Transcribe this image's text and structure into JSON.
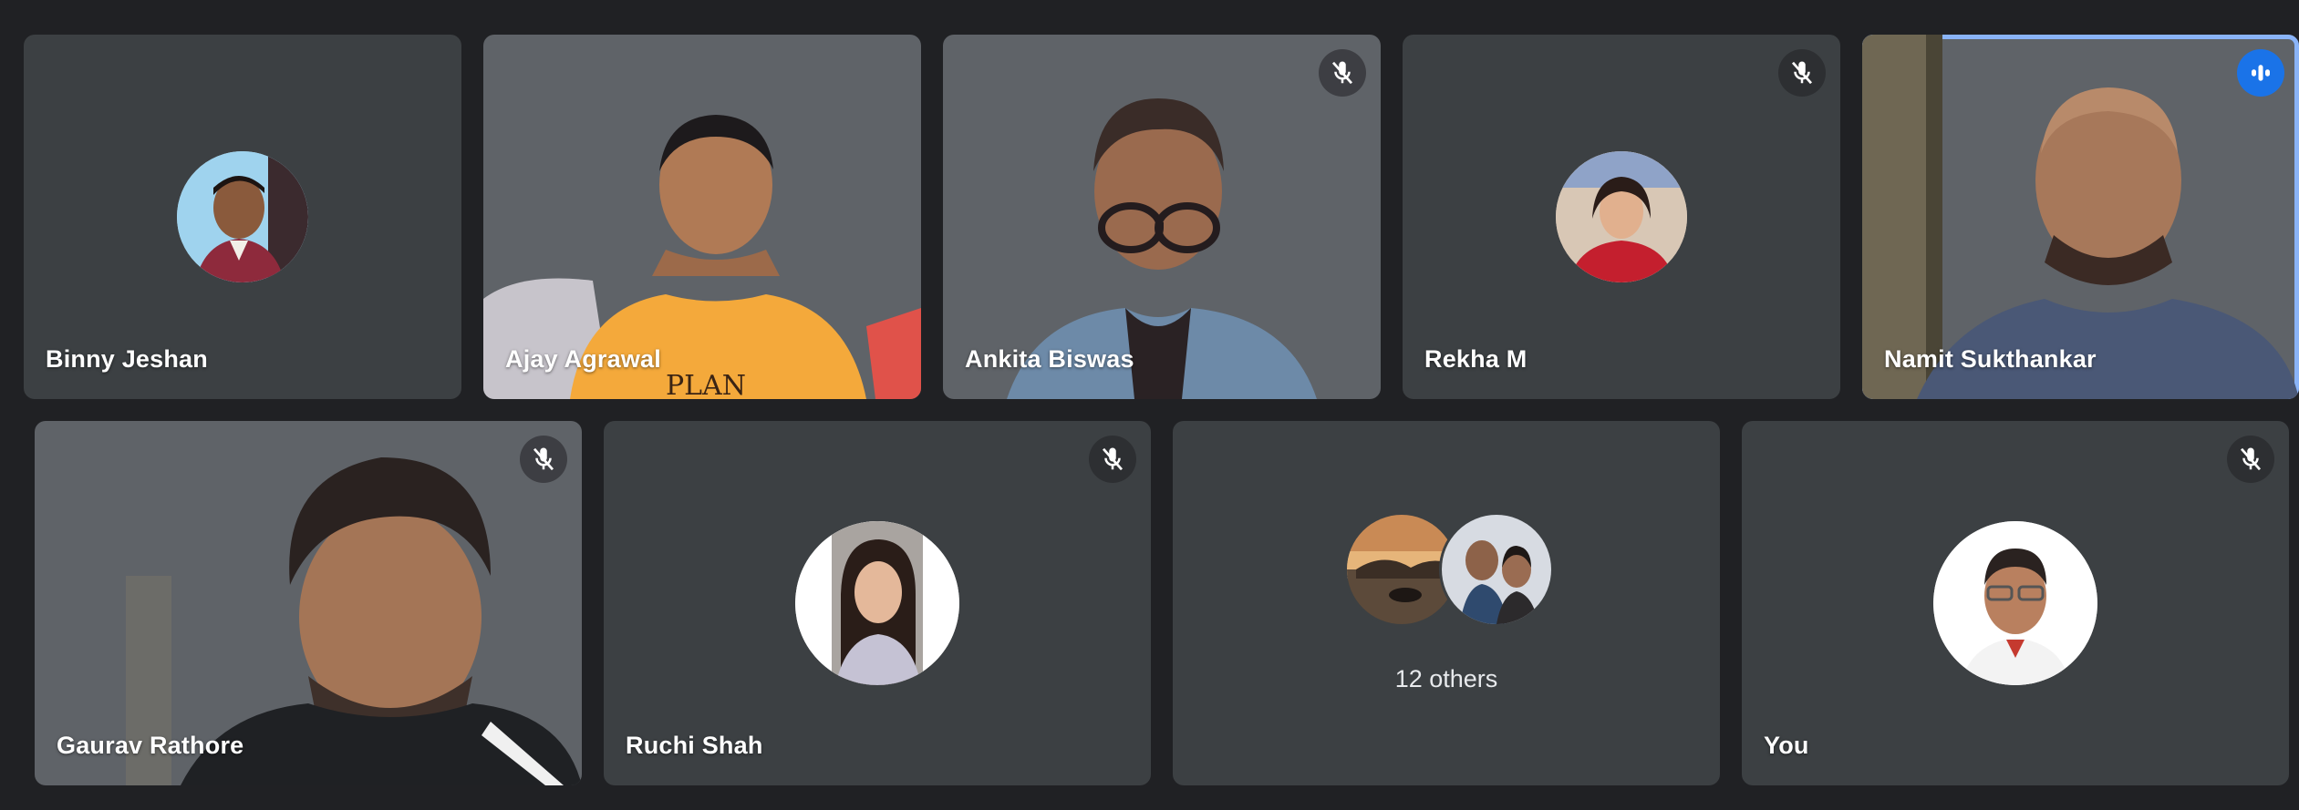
{
  "participants": [
    {
      "name": "Binny Jeshan",
      "muted": false
    },
    {
      "name": "Ajay Agrawal",
      "muted": false
    },
    {
      "name": "Ankita Biswas",
      "muted": true
    },
    {
      "name": "Rekha M",
      "muted": true
    },
    {
      "name": "Namit Sukthankar",
      "speaking": true
    },
    {
      "name": "Gaurav Rathore",
      "muted": true
    },
    {
      "name": "Ruchi Shah",
      "muted": true
    },
    {
      "name": "You",
      "muted": true
    }
  ],
  "others": {
    "label": "12 others"
  },
  "icons": {
    "muted": "mic-off-icon",
    "speaking": "audio-level-icon"
  },
  "colors": {
    "background": "#202124",
    "tile": "#3c4043",
    "speaking_outline": "#8ab4f8",
    "speaking_indicator": "#1a73e8"
  }
}
